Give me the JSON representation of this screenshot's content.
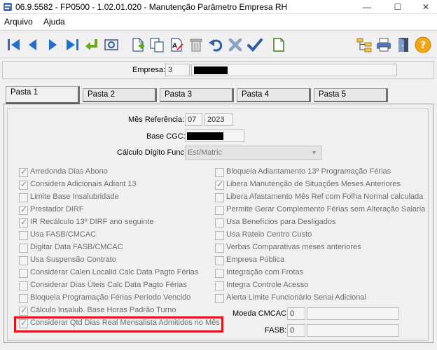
{
  "window": {
    "title": "06.9.5582 - FP0500 - 1.02.01.020 - Manutenção Parâmetro Empresa RH",
    "minimize": "—",
    "maximize": "☐",
    "close": "✕"
  },
  "menu": {
    "items": [
      {
        "label": "Arquivo"
      },
      {
        "label": "Ajuda"
      }
    ]
  },
  "toolbar": {
    "icons": [
      "first-record-icon",
      "previous-record-icon",
      "next-record-icon",
      "last-record-icon",
      "return-icon",
      "preview-icon",
      "new-document-icon",
      "copy-icon",
      "edit-icon",
      "delete-icon",
      "undo-icon",
      "cancel-icon",
      "confirm-icon",
      "blank-document-icon",
      "tree-icon",
      "print-icon",
      "exit-door-icon",
      "help-icon"
    ],
    "help_glyph": "?"
  },
  "empresa": {
    "label": "Empresa:",
    "code": "3"
  },
  "tabs": [
    {
      "label": "Pasta 1"
    },
    {
      "label": "Pasta 2"
    },
    {
      "label": "Pasta 3"
    },
    {
      "label": "Pasta 4"
    },
    {
      "label": "Pasta 5"
    }
  ],
  "form": {
    "mes_referencia": {
      "label": "Mês Referência:",
      "month": "07",
      "year": "2023"
    },
    "base_cgc": {
      "label": "Base CGC:"
    },
    "calculo_digito": {
      "label": "Cálculo Dígito Func:",
      "value": "Est/Matric"
    },
    "moeda_cmcac": {
      "label": "Moeda CMCAC:",
      "value": "0"
    },
    "fasb": {
      "label": "FASB:",
      "value": "0"
    }
  },
  "checkboxes_left": [
    {
      "label": "Arredonda Dias Abono",
      "checked": true
    },
    {
      "label": "Considera Adicionais Adiant 13",
      "checked": true
    },
    {
      "label": "Limite Base Insalubridade",
      "checked": false
    },
    {
      "label": "Prestador DIRF",
      "checked": true
    },
    {
      "label": "IR Recálculo 13º DIRF ano seguinte",
      "checked": true
    },
    {
      "label": "Usa FASB/CMCAC",
      "checked": false
    },
    {
      "label": "Digitar Data FASB/CMCAC",
      "checked": false
    },
    {
      "label": "Usa Suspensão Contrato",
      "checked": false
    },
    {
      "label": "Considerar Calen Localid Calc Data Pagto Férias",
      "checked": false
    },
    {
      "label": "Considerar Dias Úteis Calc Data Pagto Férias",
      "checked": false
    },
    {
      "label": "Bloqueia Programação Férias Período Vencido",
      "checked": false
    },
    {
      "label": "Cálculo Insalub. Base Horas Padrão Turno",
      "checked": true
    },
    {
      "label": "Considerar Qtd Dias Real Mensalista Admitidos no Mês",
      "checked": true
    }
  ],
  "checkboxes_right": [
    {
      "label": "Bloqueia Adiantamento 13º Programação Férias",
      "checked": false
    },
    {
      "label": "Libera Manutenção de Situações Meses Anteriores",
      "checked": true
    },
    {
      "label": "Libera Afastamento Mês Ref com Folha Normal calculada",
      "checked": false
    },
    {
      "label": "Permite Gerar Complemento Férias sem Alteração Salaria",
      "checked": false
    },
    {
      "label": "Usa Benefícios para Desligados",
      "checked": false
    },
    {
      "label": "Usa Rateio Centro Custo",
      "checked": false
    },
    {
      "label": "Verbas Comparativas meses anteriores",
      "checked": false
    },
    {
      "label": "Empresa Pública",
      "checked": false
    },
    {
      "label": "Integração com Frotas",
      "checked": false
    },
    {
      "label": "Integra Controle Acesso",
      "checked": false
    },
    {
      "label": "Alerta Limite Funcionário Senai Adicional",
      "checked": false
    }
  ],
  "colors": {
    "highlight": "#e0131b",
    "disabled_text": "#6d6d6d"
  }
}
